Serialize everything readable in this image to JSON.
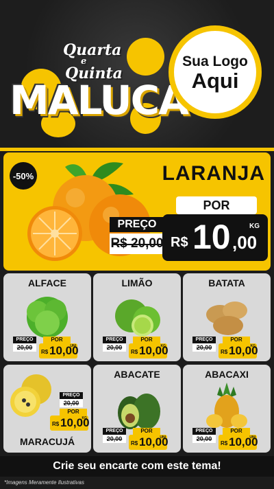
{
  "header": {
    "title_line1": "Quarta",
    "title_line2": "e",
    "title_line3": "Quinta",
    "title_main": "MALUCA",
    "logo_line1": "Sua Logo",
    "logo_line2": "Aqui"
  },
  "hero": {
    "name": "LARANJA",
    "discount": "-50%",
    "por": "POR",
    "preco": "PREÇO",
    "old_price": "R$ 20,00",
    "currency": "R$",
    "price_int": "10",
    "price_dec": ",00",
    "unit": "KG",
    "image": "orange-icon"
  },
  "products": [
    {
      "name": "ALFACE",
      "preco": "PREÇO",
      "old": "20,00",
      "por": "POR",
      "currency": "R$",
      "price": "10,00",
      "unit": "UNI",
      "image": "lettuce-icon"
    },
    {
      "name": "LIMÃO",
      "preco": "PREÇO",
      "old": "20,00",
      "por": "POR",
      "currency": "R$",
      "price": "10,00",
      "unit": "KG",
      "image": "lime-icon"
    },
    {
      "name": "BATATA",
      "preco": "PREÇO",
      "old": "20,00",
      "por": "POR",
      "currency": "R$",
      "price": "10,00",
      "unit": "KG",
      "image": "potato-icon"
    },
    {
      "name": "MARACUJÁ",
      "preco": "PREÇO",
      "old": "20,00",
      "por": "POR",
      "currency": "R$",
      "price": "10,00",
      "unit": "KG",
      "image": "passionfruit-icon"
    },
    {
      "name": "ABACATE",
      "preco": "PREÇO",
      "old": "20,00",
      "por": "POR",
      "currency": "R$",
      "price": "10,00",
      "unit": "UNI",
      "image": "avocado-icon"
    },
    {
      "name": "ABACAXI",
      "preco": "PREÇO",
      "old": "20,00",
      "por": "POR",
      "currency": "R$",
      "price": "10,00",
      "unit": "UNI",
      "image": "pineapple-icon"
    }
  ],
  "footer": {
    "cta": "Crie seu encarte com este tema!",
    "disclaimer": "*Imagens Meramente Ilustrativas"
  },
  "colors": {
    "accent": "#f6c400",
    "dark": "#111111",
    "card": "#d9d9d9"
  }
}
